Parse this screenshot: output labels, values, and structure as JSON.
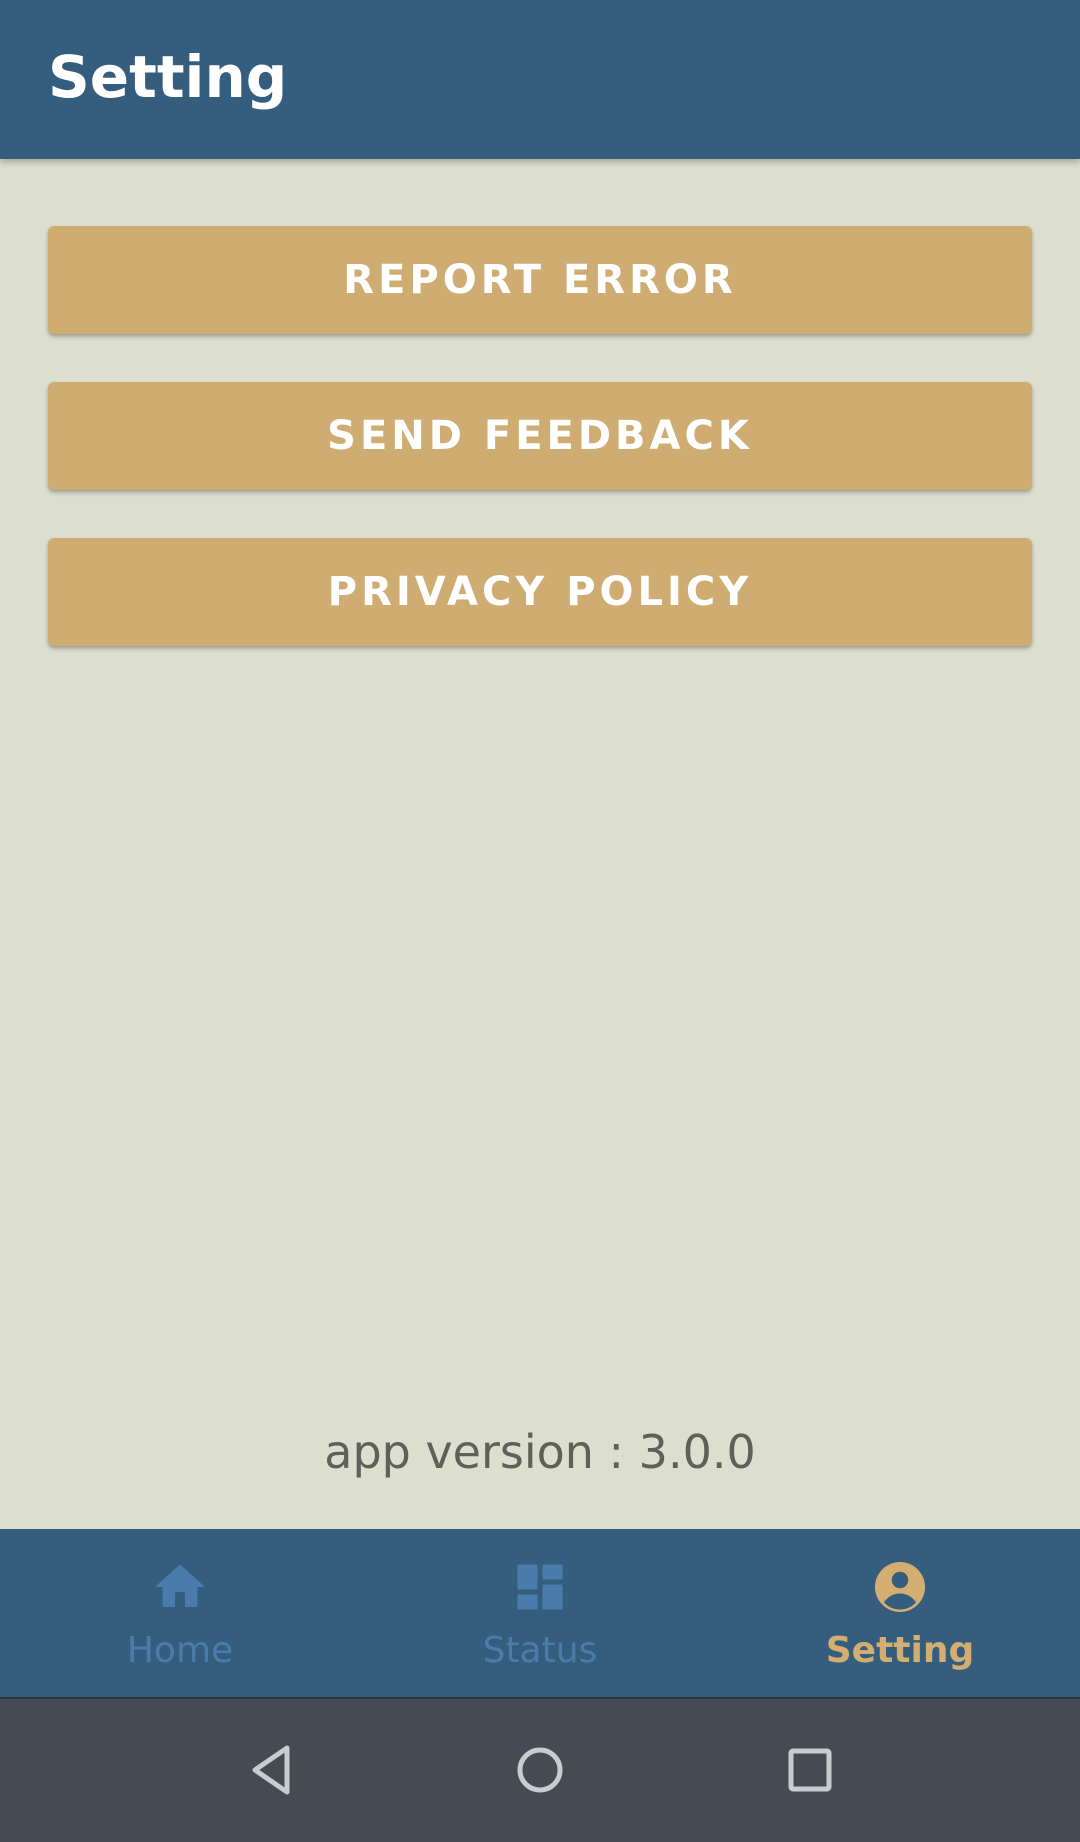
{
  "app_bar": {
    "title": "Setting",
    "background_color": "#345d7e"
  },
  "actions": [
    {
      "label": "REPORT ERROR"
    },
    {
      "label": "SEND FEEDBACK"
    },
    {
      "label": "PRIVACY POLICY"
    }
  ],
  "version_text": "app version : 3.0.0",
  "bottom_nav": {
    "items": [
      {
        "label": "Home",
        "icon": "home-icon",
        "active": false
      },
      {
        "label": "Status",
        "icon": "dashboard-icon",
        "active": false
      },
      {
        "label": "Setting",
        "icon": "account-circle-icon",
        "active": true
      }
    ],
    "active_color": "#d4ae70",
    "inactive_color": "#4a7cab"
  },
  "system_nav": {
    "buttons": [
      "back-icon",
      "home-circle-icon",
      "recent-apps-icon"
    ]
  },
  "colors": {
    "button": "#cfad72",
    "background": "#dcdfce",
    "system_bar": "#454b52"
  }
}
